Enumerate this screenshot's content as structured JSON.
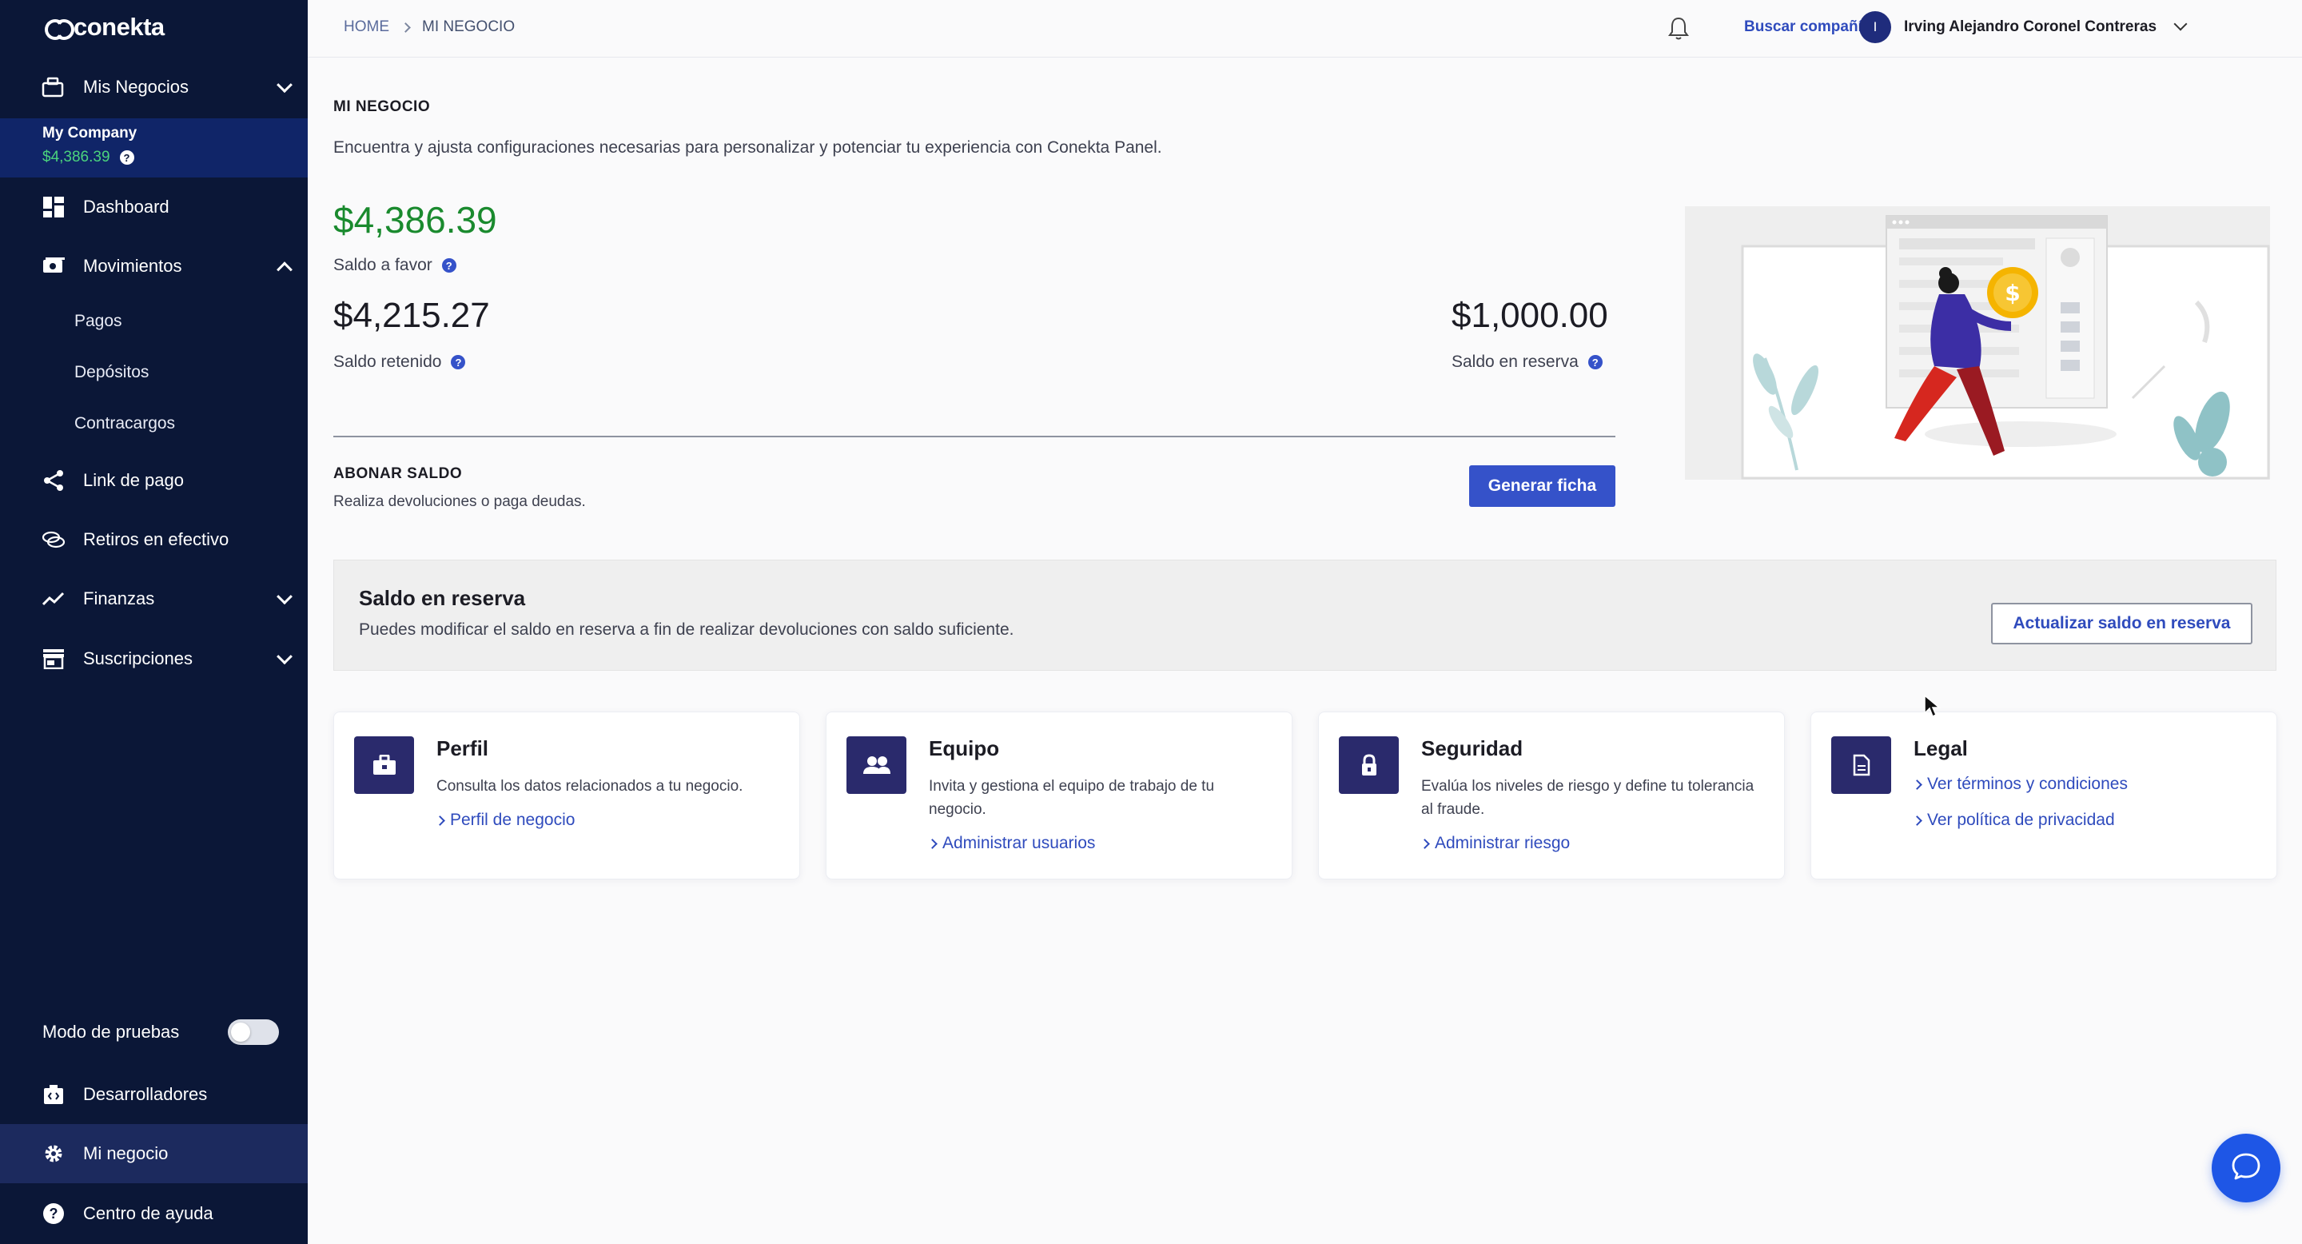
{
  "brand": {
    "logo_text": "conekta"
  },
  "sidebar": {
    "business_menu": {
      "label": "Mis Negocios",
      "icon": "briefcase-icon"
    },
    "company": {
      "name": "My Company",
      "balance": "$4,386.39"
    },
    "items": [
      {
        "label": "Dashboard",
        "icon": "dashboard-icon"
      },
      {
        "label": "Movimientos",
        "icon": "money-icon",
        "expanded": true
      },
      {
        "label": "Link de pago",
        "icon": "share-icon"
      },
      {
        "label": "Retiros en efectivo",
        "icon": "cash-icon"
      },
      {
        "label": "Finanzas",
        "icon": "trend-icon"
      },
      {
        "label": "Suscripciones",
        "icon": "store-icon"
      }
    ],
    "subitems": [
      "Pagos",
      "Depósitos",
      "Contracargos"
    ],
    "test_mode": {
      "label": "Modo de pruebas",
      "enabled": false
    },
    "bottom_items": [
      {
        "label": "Desarrolladores",
        "icon": "code-icon"
      },
      {
        "label": "Mi negocio",
        "icon": "gear-icon",
        "active": true
      },
      {
        "label": "Centro de ayuda",
        "icon": "help-icon"
      }
    ]
  },
  "topbar": {
    "breadcrumb": [
      "HOME",
      "MI NEGOCIO"
    ],
    "search_company": "Buscar compañía",
    "user": {
      "initial": "I",
      "name": "Irving Alejandro Coronel Contreras"
    }
  },
  "main": {
    "title": "MI NEGOCIO",
    "description": "Encuentra y ajusta configuraciones necesarias para personalizar y potenciar tu experiencia con Conekta Panel.",
    "balances": {
      "favor": {
        "amount": "$4,386.39",
        "label": "Saldo a favor"
      },
      "retenido": {
        "amount": "$4,215.27",
        "label": "Saldo retenido"
      },
      "reserva": {
        "amount": "$1,000.00",
        "label": "Saldo en reserva"
      }
    },
    "abonar": {
      "title": "ABONAR SALDO",
      "description": "Realiza devoluciones o paga deudas.",
      "button": "Generar ficha"
    },
    "reserve": {
      "title": "Saldo en reserva",
      "description": "Puedes modificar el saldo en reserva a fin de realizar devoluciones con saldo suficiente.",
      "button": "Actualizar saldo en reserva"
    },
    "cards": [
      {
        "title": "Perfil",
        "icon": "briefcase-icon",
        "description": "Consulta los datos relacionados a tu negocio.",
        "links": [
          "Perfil de negocio"
        ]
      },
      {
        "title": "Equipo",
        "icon": "people-icon",
        "description": "Invita y gestiona el equipo de trabajo de tu negocio.",
        "links": [
          "Administrar usuarios"
        ]
      },
      {
        "title": "Seguridad",
        "icon": "lock-icon",
        "description": "Evalúa los niveles de riesgo y define tu tolerancia al fraude.",
        "links": [
          "Administrar riesgo"
        ]
      },
      {
        "title": "Legal",
        "icon": "document-icon",
        "description": "",
        "links": [
          "Ver términos y condiciones",
          "Ver política de privacidad"
        ]
      }
    ]
  },
  "colors": {
    "sidebar_bg": "#0b1737",
    "accent": "#3552c9",
    "positive": "#1a8a2e",
    "card_icon_bg": "#2a2a6c",
    "chat_button": "#1e56e6"
  }
}
